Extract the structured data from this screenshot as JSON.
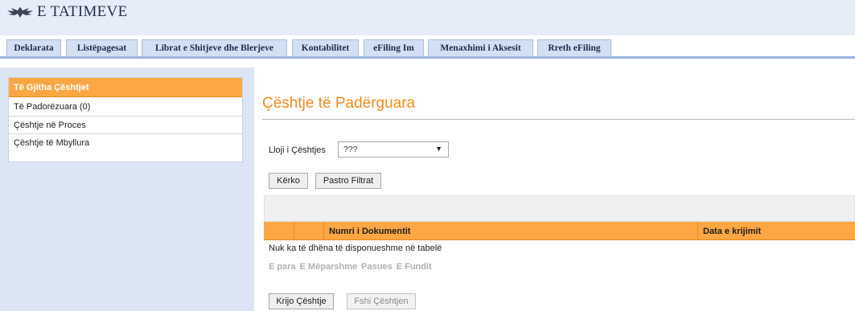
{
  "header": {
    "logo_text": "E TATIMEVE",
    "emblem_icon": "eagle-emblem-icon"
  },
  "tabs": [
    {
      "label": "Deklarata"
    },
    {
      "label": "Listëpagesat"
    },
    {
      "label": "Librat e Shitjeve dhe Blerjeve"
    },
    {
      "label": "Kontabilitet"
    },
    {
      "label": "eFiling Im"
    },
    {
      "label": "Menaxhimi i Aksesit"
    },
    {
      "label": "Rreth eFiling"
    }
  ],
  "sidebar": {
    "heading": "Të Gjitha Çështjet",
    "items": [
      {
        "label": "Të Padorëzuara (0)"
      },
      {
        "label": "Çështje në Proces"
      },
      {
        "label": "Çështje të Mbyllura"
      }
    ]
  },
  "main": {
    "title": "Çështje të Padërguara",
    "filter": {
      "label": "Lloji i Çështjes",
      "selected": "???",
      "arrow_icon": "dropdown-arrow-icon"
    },
    "search_button": "Kërko",
    "clear_button": "Pastro Filtrat",
    "table": {
      "columns": [
        "",
        "",
        "Numri i Dokumentit",
        "Data e krijimit"
      ],
      "empty_message": "Nuk ka të dhëna të disponueshme në tabelë",
      "pager": [
        "E para",
        "E Mëparshme",
        "Pasues",
        "E Fundit"
      ]
    },
    "create_button": "Krijo Çështje",
    "delete_button": "Fshi Çështjen"
  },
  "colors": {
    "accent_orange": "#fca644",
    "title_orange": "#f08c1e",
    "header_bg": "#e6ecf8",
    "tab_bg": "#d3dff2",
    "sidebar_bg": "#dce5f3"
  }
}
